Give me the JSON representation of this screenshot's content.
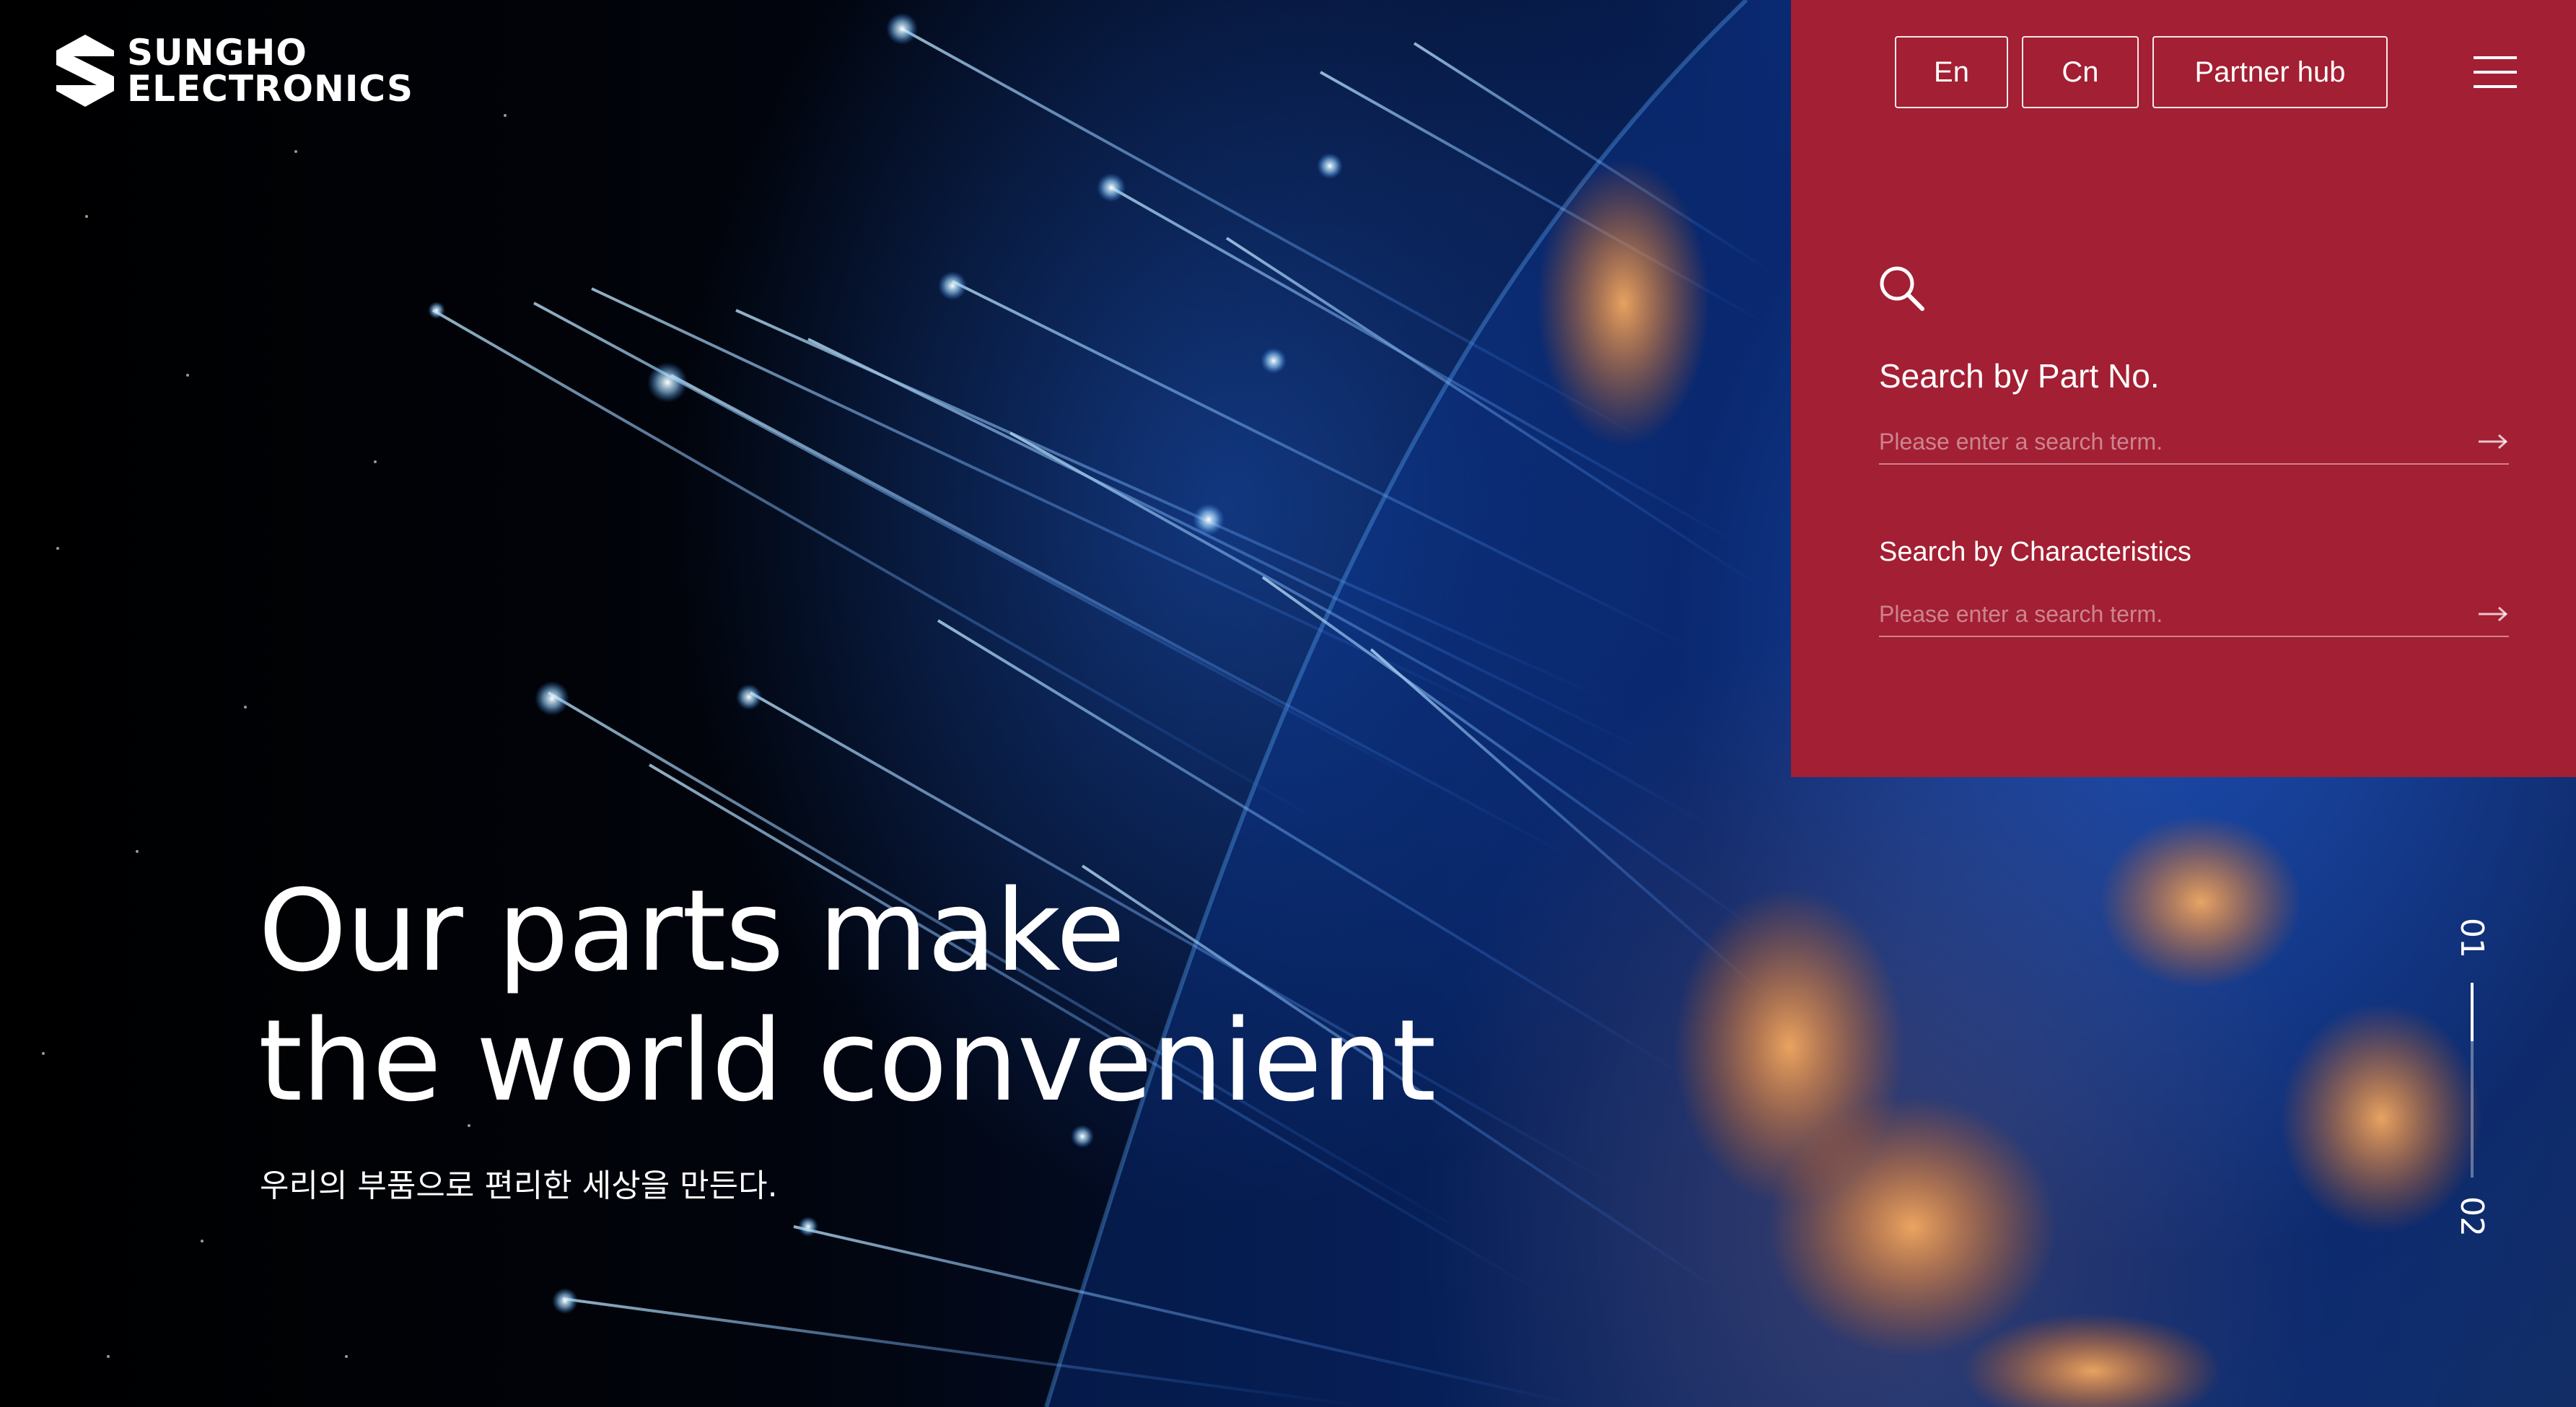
{
  "brand": {
    "line1": "SUNGHO",
    "line2": "ELECTRONICS"
  },
  "header": {
    "lang_en": "En",
    "lang_cn": "Cn",
    "partner_hub": "Partner hub"
  },
  "search": {
    "part_no_title": "Search by Part No.",
    "part_no_placeholder": "Please enter a search term.",
    "characteristics_title": "Search by Characteristics",
    "characteristics_placeholder": "Please enter a search term."
  },
  "hero": {
    "line1": "Our parts make",
    "line2": "the world convenient",
    "subtitle": "우리의 부품으로 편리한 세상을 만든다."
  },
  "slider": {
    "current": "01",
    "next": "02",
    "progress": 0.3
  },
  "colors": {
    "panel": "#a31f33",
    "text": "#ffffff"
  }
}
